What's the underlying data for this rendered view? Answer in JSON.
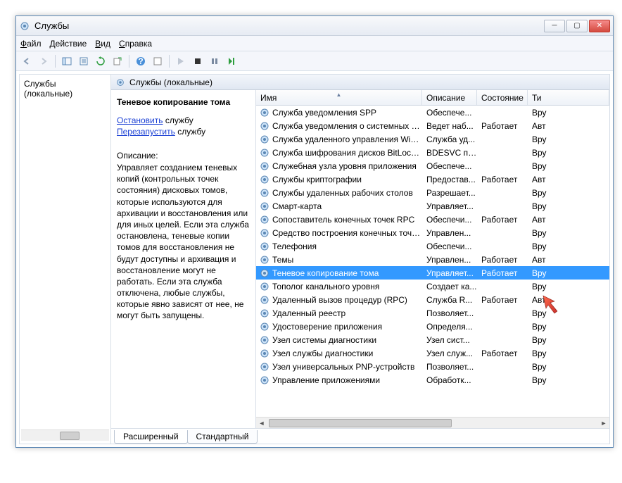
{
  "window": {
    "title": "Службы"
  },
  "menu": {
    "file": "Файл",
    "action": "Действие",
    "view": "Вид",
    "help": "Справка"
  },
  "tree": {
    "root": "Службы (локальные)"
  },
  "header": {
    "caption": "Службы (локальные)"
  },
  "detail": {
    "service_name": "Теневое копирование тома",
    "stop_link": "Остановить",
    "stop_suffix": " службу",
    "restart_link": "Перезапустить",
    "restart_suffix": " службу",
    "desc_heading": "Описание:",
    "desc_body": "Управляет созданием теневых копий (контрольных точек состояния) дисковых томов, которые используются для архивации и восстановления или для иных целей. Если эта служба остановлена, теневые копии томов для восстановления не будут доступны и архивация и восстановление могут не работать. Если эта служба отключена, любые службы, которые явно зависят от нее, не могут быть запущены."
  },
  "columns": {
    "name": "Имя",
    "desc": "Описание",
    "state": "Состояние",
    "type": "Ти"
  },
  "services": [
    {
      "name": "Служба уведомления SPP",
      "desc": "Обеспече...",
      "state": "",
      "type": "Вру"
    },
    {
      "name": "Служба уведомления о системных соб...",
      "desc": "Ведет наб...",
      "state": "Работает",
      "type": "Авт"
    },
    {
      "name": "Служба удаленного управления Windo...",
      "desc": "Служба уд...",
      "state": "",
      "type": "Вру"
    },
    {
      "name": "Служба шифрования дисков BitLocker",
      "desc": "BDESVC пр...",
      "state": "",
      "type": "Вру"
    },
    {
      "name": "Служебная узла уровня приложения",
      "desc": "Обеспече...",
      "state": "",
      "type": "Вру"
    },
    {
      "name": "Службы криптографии",
      "desc": "Предостав...",
      "state": "Работает",
      "type": "Авт"
    },
    {
      "name": "Службы удаленных рабочих столов",
      "desc": "Разрешает...",
      "state": "",
      "type": "Вру"
    },
    {
      "name": "Смарт-карта",
      "desc": "Управляет...",
      "state": "",
      "type": "Вру"
    },
    {
      "name": "Сопоставитель конечных точек RPC",
      "desc": "Обеспечи...",
      "state": "Работает",
      "type": "Авт"
    },
    {
      "name": "Средство построения конечных точек ...",
      "desc": "Управлен...",
      "state": "",
      "type": "Вру"
    },
    {
      "name": "Телефония",
      "desc": "Обеспечи...",
      "state": "",
      "type": "Вру"
    },
    {
      "name": "Темы",
      "desc": "Управлен...",
      "state": "Работает",
      "type": "Авт"
    },
    {
      "name": "Теневое копирование тома",
      "desc": "Управляет...",
      "state": "Работает",
      "type": "Вру",
      "selected": true
    },
    {
      "name": "Тополог канального уровня",
      "desc": "Создает ка...",
      "state": "",
      "type": "Вру"
    },
    {
      "name": "Удаленный вызов процедур (RPC)",
      "desc": "Служба R...",
      "state": "Работает",
      "type": "Авт"
    },
    {
      "name": "Удаленный реестр",
      "desc": "Позволяет...",
      "state": "",
      "type": "Вру"
    },
    {
      "name": "Удостоверение приложения",
      "desc": "Определя...",
      "state": "",
      "type": "Вру"
    },
    {
      "name": "Узел системы диагностики",
      "desc": "Узел сист...",
      "state": "",
      "type": "Вру"
    },
    {
      "name": "Узел службы диагностики",
      "desc": "Узел служ...",
      "state": "Работает",
      "type": "Вру"
    },
    {
      "name": "Узел универсальных PNP-устройств",
      "desc": "Позволяет...",
      "state": "",
      "type": "Вру"
    },
    {
      "name": "Управление приложениями",
      "desc": "Обработк...",
      "state": "",
      "type": "Вру"
    }
  ],
  "tabs": {
    "extended": "Расширенный",
    "standard": "Стандартный"
  }
}
